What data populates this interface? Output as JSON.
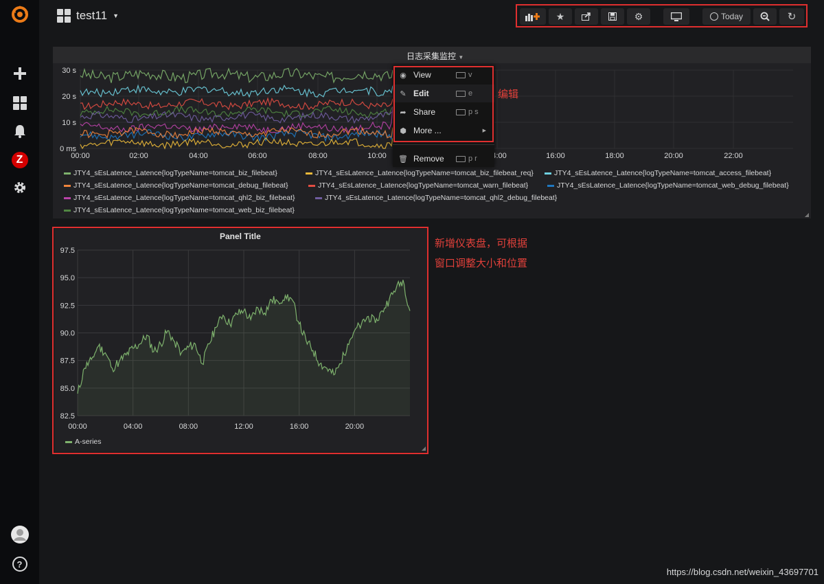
{
  "app": {
    "brand_color": "#eb7b18"
  },
  "sidebar": {
    "items": [
      "create-icon",
      "dashboards-icon",
      "alerting-icon",
      "zabbix-icon",
      "configuration-icon"
    ],
    "zabbix_label": "Z",
    "help_label": "?"
  },
  "header": {
    "dashboard_name": "test11"
  },
  "toolbar": {
    "time_label": "Today"
  },
  "panel1": {
    "title": "日志采集监控",
    "y_ticks": [
      "30 s",
      "20 s",
      "10 s",
      "0 ms"
    ],
    "x_ticks": [
      "00:00",
      "02:00",
      "04:00",
      "06:00",
      "08:00",
      "10:00",
      "14:00",
      "16:00",
      "18:00",
      "20:00",
      "22:00"
    ],
    "legend": [
      {
        "label": "JTY4_sEsLatence_Latence{logTypeName=tomcat_biz_filebeat}",
        "color": "#7eb26d"
      },
      {
        "label": "JTY4_sEsLatence_Latence{logTypeName=tomcat_biz_filebeat_req}",
        "color": "#eab839"
      },
      {
        "label": "JTY4_sEsLatence_Latence{logTypeName=tomcat_access_filebeat}",
        "color": "#6ed0e0"
      },
      {
        "label": "JTY4_sEsLatence_Latence{logTypeName=tomcat_debug_filebeat}",
        "color": "#ef843c"
      },
      {
        "label": "JTY4_sEsLatence_Latence{logTypeName=tomcat_warn_filebeat}",
        "color": "#e24d42"
      },
      {
        "label": "JTY4_sEsLatence_Latence{logTypeName=tomcat_web_debug_filebeat}",
        "color": "#1f78c1"
      },
      {
        "label": "JTY4_sEsLatence_Latence{logTypeName=tomcat_qhl2_biz_filebeat}",
        "color": "#ba43a9"
      },
      {
        "label": "JTY4_sEsLatence_Latence{logTypeName=tomcat_qhl2_debug_filebeat}",
        "color": "#705da0"
      },
      {
        "label": "JTY4_sEsLatence_Latence{logTypeName=tomcat_web_biz_filebeat}",
        "color": "#508642"
      }
    ]
  },
  "context_menu": {
    "items": [
      {
        "label": "View",
        "shortcut": "v"
      },
      {
        "label": "Edit",
        "shortcut": "e"
      },
      {
        "label": "Share",
        "shortcut": "p s"
      },
      {
        "label": "More ...",
        "shortcut": ""
      },
      {
        "label": "Remove",
        "shortcut": "p r"
      }
    ]
  },
  "panel2": {
    "title": "Panel Title",
    "legend_label": "A-series",
    "series_color": "#7eb26d"
  },
  "chart_data": {
    "type": "line",
    "title": "Panel Title",
    "x_ticks": [
      "00:00",
      "04:00",
      "08:00",
      "12:00",
      "16:00",
      "20:00"
    ],
    "y_ticks": [
      "97.5",
      "95.0",
      "92.5",
      "90.0",
      "87.5",
      "85.0",
      "82.5"
    ],
    "ylim": [
      82.5,
      97.5
    ],
    "grid": true,
    "legend_position": "bottom-left",
    "series": [
      {
        "name": "A-series",
        "color": "#7eb26d",
        "x": [
          0,
          0.5,
          1,
          1.5,
          2,
          2.5,
          3,
          3.5,
          4,
          4.5,
          5,
          5.5,
          6,
          6.5,
          7,
          7.5,
          8,
          8.5,
          9,
          9.5,
          10,
          10.5,
          11,
          11.5,
          12,
          12.5,
          13,
          13.5,
          14,
          14.5,
          15,
          15.5,
          16,
          16.5,
          17,
          17.5,
          18,
          18.5,
          19,
          19.5,
          20,
          20.5,
          21,
          21.5,
          22,
          22.5,
          23,
          23.5,
          24
        ],
        "values": [
          84.5,
          86.8,
          87.6,
          88.8,
          88.2,
          86.8,
          87.4,
          88.0,
          88.6,
          89.0,
          89.8,
          88.3,
          89.0,
          90.2,
          89.2,
          88.2,
          88.7,
          89.0,
          87.2,
          89.0,
          90.5,
          91.6,
          90.8,
          91.7,
          92.0,
          91.2,
          92.3,
          91.8,
          93.0,
          92.8,
          93.4,
          93.0,
          90.8,
          89.3,
          88.4,
          87.2,
          86.8,
          86.2,
          87.2,
          89.0,
          90.2,
          90.8,
          91.5,
          90.9,
          92.0,
          93.0,
          94.0,
          94.8,
          92.0
        ]
      }
    ]
  },
  "annotations": {
    "edit_note": "编辑",
    "new_panel_line1": "新增仪表盘，可根据",
    "new_panel_line2": "窗口调整大小和位置"
  },
  "watermark": "https://blog.csdn.net/weixin_43697701"
}
